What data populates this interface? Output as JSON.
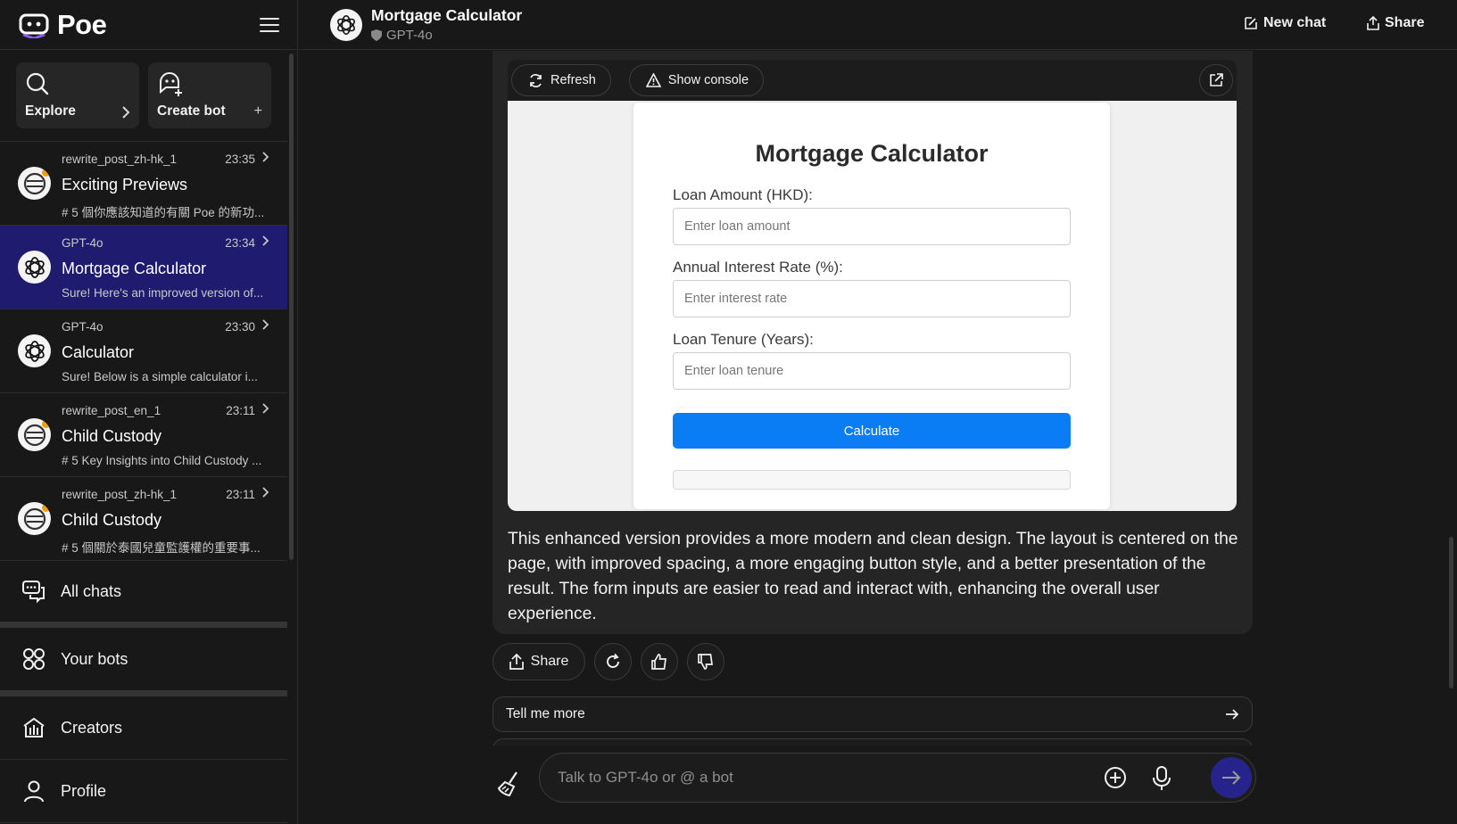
{
  "app": {
    "name": "Poe"
  },
  "sidebar": {
    "explore_label": "Explore",
    "create_bot_label": "Create bot",
    "chats": [
      {
        "bot": "rewrite_post_zh-hk_1",
        "time": "23:35",
        "title": "Exciting Previews",
        "snippet": "# 5 個你應該知道的有關 Poe 的新功...",
        "avatar": "rewrite-bot-icon",
        "active": false
      },
      {
        "bot": "GPT-4o",
        "time": "23:34",
        "title": "Mortgage Calculator",
        "snippet": "Sure! Here's an improved version of...",
        "avatar": "openai-icon",
        "active": true
      },
      {
        "bot": "GPT-4o",
        "time": "23:30",
        "title": "Calculator",
        "snippet": "Sure! Below is a simple calculator i...",
        "avatar": "openai-icon",
        "active": false
      },
      {
        "bot": "rewrite_post_en_1",
        "time": "23:11",
        "title": "Child Custody",
        "snippet": "# 5 Key Insights into Child Custody ...",
        "avatar": "rewrite-bot-icon",
        "active": false
      },
      {
        "bot": "rewrite_post_zh-hk_1",
        "time": "23:11",
        "title": "Child Custody",
        "snippet": "# 5 個關於泰國兒童監護權的重要事...",
        "avatar": "rewrite-bot-icon",
        "active": false
      }
    ],
    "nav": {
      "all_chats": "All chats",
      "your_bots": "Your bots",
      "creators": "Creators",
      "profile": "Profile"
    }
  },
  "header": {
    "title": "Mortgage Calculator",
    "bot_name": "GPT-4o",
    "new_chat_label": "New chat",
    "share_label": "Share"
  },
  "preview": {
    "refresh_label": "Refresh",
    "console_label": "Show console",
    "calc": {
      "title": "Mortgage Calculator",
      "loan_label": "Loan Amount (HKD):",
      "loan_placeholder": "Enter loan amount",
      "rate_label": "Annual Interest Rate (%):",
      "rate_placeholder": "Enter interest rate",
      "tenure_label": "Loan Tenure (Years):",
      "tenure_placeholder": "Enter loan tenure",
      "button_label": "Calculate"
    }
  },
  "message": {
    "text": "This enhanced version provides a more modern and clean design. The layout is centered on the page, with improved spacing, a more engaging button style, and a better presentation of the result. The form inputs are easier to read and interact with, enhancing the overall user experience."
  },
  "actions": {
    "share_label": "Share"
  },
  "suggestion": {
    "label": "Tell me more"
  },
  "composer": {
    "placeholder": "Talk to GPT-4o or @ a bot"
  },
  "colors": {
    "accent": "#27238c",
    "active_chat": "#1f1b6e",
    "calc_button": "#0a7cf4"
  }
}
